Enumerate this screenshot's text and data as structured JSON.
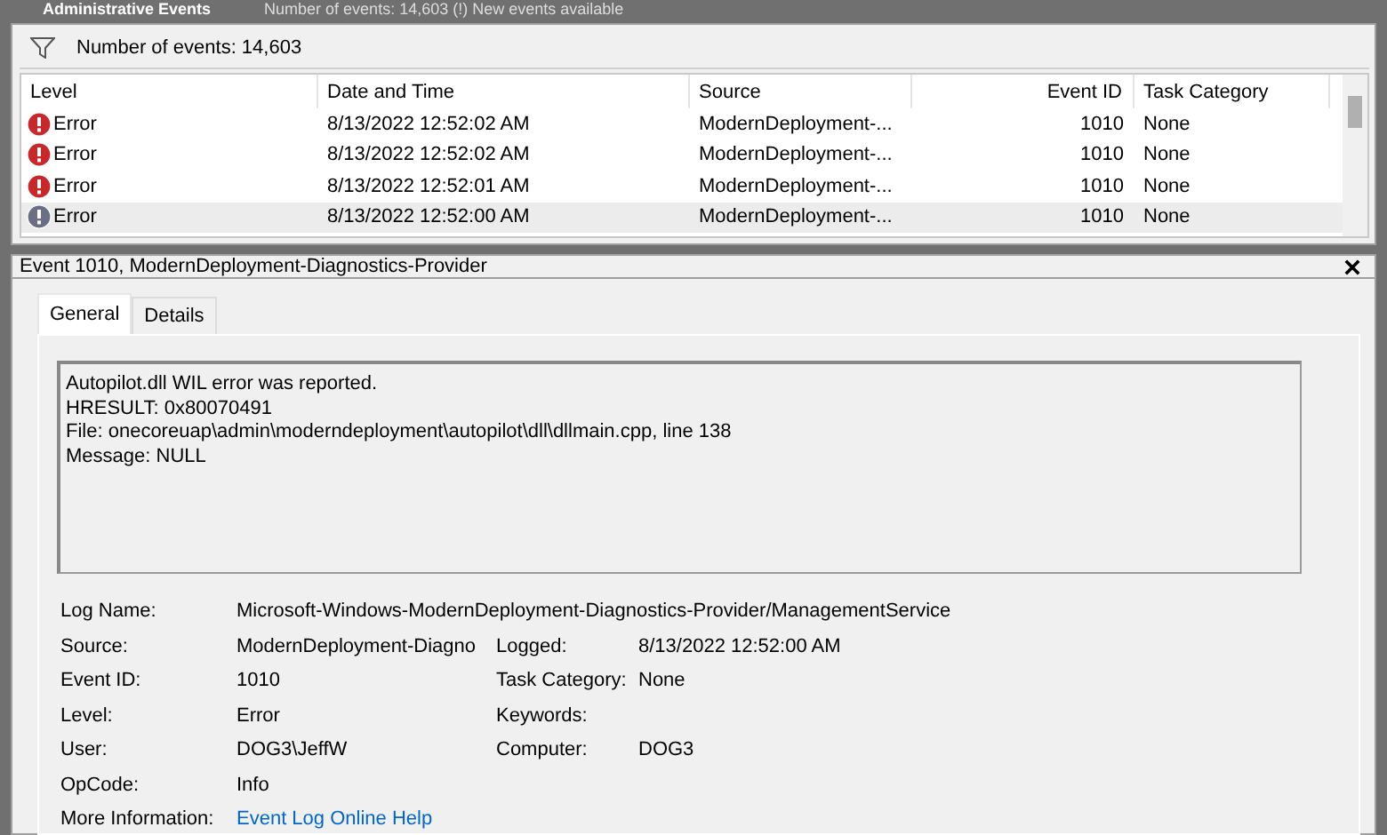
{
  "header": {
    "title": "Administrative Events",
    "summary": "Number of events: 14,603 (!) New events available"
  },
  "filter_bar": {
    "text": "Number of events: 14,603"
  },
  "table": {
    "columns": [
      "Level",
      "Date and Time",
      "Source",
      "Event ID",
      "Task Category"
    ],
    "rows": [
      {
        "level": "Error",
        "date": "8/13/2022 12:52:02 AM",
        "source": "ModernDeployment-...",
        "event_id": "1010",
        "category": "None",
        "selected": false
      },
      {
        "level": "Error",
        "date": "8/13/2022 12:52:02 AM",
        "source": "ModernDeployment-...",
        "event_id": "1010",
        "category": "None",
        "selected": false
      },
      {
        "level": "Error",
        "date": "8/13/2022 12:52:01 AM",
        "source": "ModernDeployment-...",
        "event_id": "1010",
        "category": "None",
        "selected": false
      },
      {
        "level": "Error",
        "date": "8/13/2022 12:52:00 AM",
        "source": "ModernDeployment-...",
        "event_id": "1010",
        "category": "None",
        "selected": true
      }
    ]
  },
  "detail": {
    "title": "Event 1010, ModernDeployment-Diagnostics-Provider",
    "tabs": [
      {
        "label": "General",
        "selected": true
      },
      {
        "label": "Details",
        "selected": false
      }
    ],
    "message": [
      "Autopilot.dll WIL error was reported.",
      "HRESULT: 0x80070491",
      "File: onecoreuap\\admin\\moderndeployment\\autopilot\\dll\\dllmain.cpp, line 138",
      "Message: NULL"
    ],
    "properties": [
      [
        {
          "label": "Log Name:",
          "value": "Microsoft-Windows-ModernDeployment-Diagnostics-Provider/ManagementService",
          "kind": "wide"
        }
      ],
      [
        {
          "label": "Source:",
          "value": "ModernDeployment-Diagno"
        },
        {
          "label": "Logged:",
          "value": "8/13/2022 12:52:00 AM"
        }
      ],
      [
        {
          "label": "Event ID:",
          "value": "1010"
        },
        {
          "label": "Task Category:",
          "value": "None"
        }
      ],
      [
        {
          "label": "Level:",
          "value": "Error"
        },
        {
          "label": "Keywords:"
        }
      ],
      [
        {
          "label": "User:",
          "value": "DOG3\\JeffW"
        },
        {
          "label": "Computer:",
          "value": "DOG3"
        }
      ],
      [
        {
          "label": "OpCode:",
          "value": "Info"
        }
      ],
      [
        {
          "label": "More Information:",
          "value": "Event Log Online Help",
          "kind": "link"
        }
      ]
    ]
  }
}
